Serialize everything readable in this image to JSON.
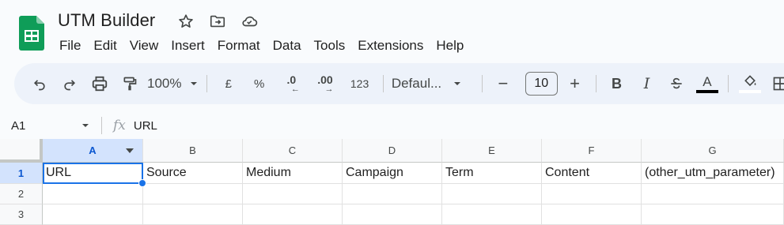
{
  "app": {
    "title": "UTM Builder",
    "icons": [
      "star-icon",
      "move-folder-icon",
      "cloud-status-icon"
    ],
    "brand_color": "#0f9d58"
  },
  "menu": [
    "File",
    "Edit",
    "View",
    "Insert",
    "Format",
    "Data",
    "Tools",
    "Extensions",
    "Help"
  ],
  "toolbar": {
    "zoom": "100%",
    "currency": "£",
    "percent": "%",
    "dec_decrease": ".0",
    "dec_increase": ".00",
    "number_format": "123",
    "font": "Defaul...",
    "font_size": "10",
    "minus": "−",
    "plus": "+",
    "bold": "B",
    "italic": "I",
    "text_color": "A",
    "text_color_bar": "#000000"
  },
  "formula_bar": {
    "cell_ref": "A1",
    "fx": "fx",
    "value": "URL"
  },
  "grid": {
    "columns": [
      "A",
      "B",
      "C",
      "D",
      "E",
      "F",
      "G"
    ],
    "rows": [
      "1",
      "2",
      "3"
    ],
    "row1": [
      "URL",
      "Source",
      "Medium",
      "Campaign",
      "Term",
      "Content",
      "(other_utm_parameter)"
    ],
    "selection_color": "#1a73e8"
  }
}
